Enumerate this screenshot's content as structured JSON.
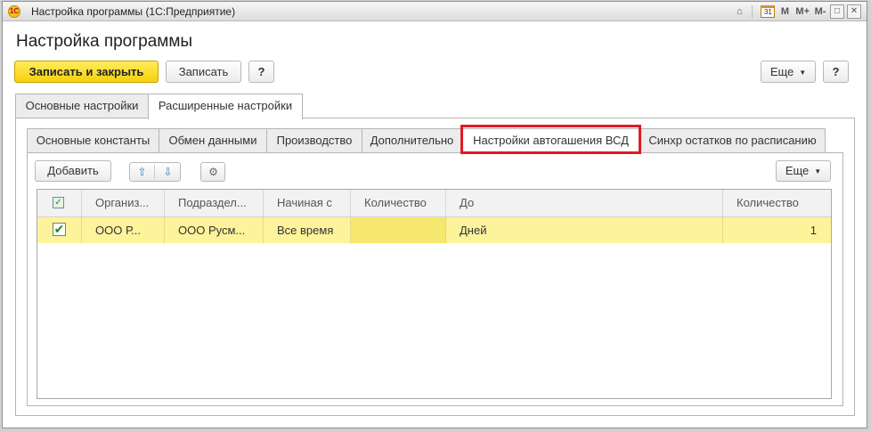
{
  "window": {
    "title": "Настройка программы  (1С:Предприятие)",
    "logo_text": "1С",
    "title_icons": {
      "home": "⌂",
      "calculator": "",
      "calendar": "31",
      "m": "M",
      "m_plus": "M+",
      "m_minus": "M-",
      "restore": "□",
      "close": "✕"
    }
  },
  "page": {
    "title": "Настройка программы"
  },
  "toolbar": {
    "save_close_label": "Записать и закрыть",
    "save_label": "Записать",
    "help_label": "?",
    "more_label": "Еще",
    "help_right_label": "?"
  },
  "outer_tabs": [
    {
      "label": "Основные настройки"
    },
    {
      "label": "Расширенные настройки"
    }
  ],
  "inner_tabs": [
    {
      "label": "Основные константы"
    },
    {
      "label": "Обмен данными"
    },
    {
      "label": "Производство"
    },
    {
      "label": "Дополнительно"
    },
    {
      "label": "Настройки автогашения ВСД"
    },
    {
      "label": "Синхр остатков по расписанию"
    }
  ],
  "table_toolbar": {
    "add_label": "Добавить",
    "up_icon": "⇧",
    "down_icon": "⇩",
    "settings_icon": "⚙",
    "more_label": "Еще"
  },
  "table": {
    "columns": [
      "Организ...",
      "Подраздел...",
      "Начиная с",
      "Количество",
      "До",
      "Количество"
    ],
    "rows": [
      {
        "checked": "✔",
        "cells": [
          "ООО Р...",
          "ООО Русм...",
          "Все время",
          "",
          "Дней",
          "1"
        ]
      }
    ]
  },
  "colors": {
    "primary_button": "#f6d10a",
    "selected_row": "#fdf39b",
    "highlight_box": "#e01b24"
  }
}
